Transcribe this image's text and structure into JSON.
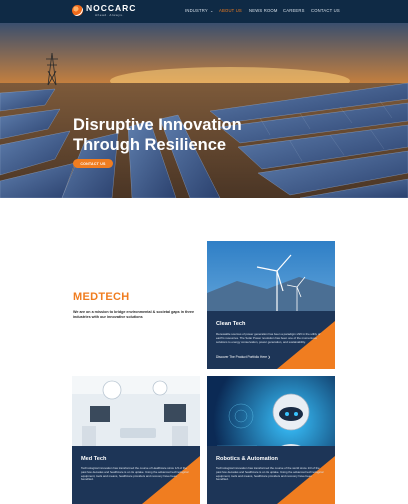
{
  "brand": {
    "name": "NOCCARC",
    "tagline": "Ahead. Always."
  },
  "nav": {
    "items": [
      {
        "label": "INDUSTRY",
        "has_dropdown": true
      },
      {
        "label": "ABOUT US",
        "active": true
      },
      {
        "label": "NEWS ROOM"
      },
      {
        "label": "CAREERS"
      },
      {
        "label": "CONTACT US"
      }
    ]
  },
  "hero": {
    "title": "Disruptive Innovation\nThrough Resilience",
    "cta_label": "CONTACT US",
    "slide_count": 5,
    "active_slide": 2
  },
  "section": {
    "title": "MEDTECH",
    "text": "We are on a mission to bridge environmental & societal gaps in three industries with our innovative solutions"
  },
  "cards": [
    {
      "title": "Clean Tech",
      "text": "Renewable sources of power generation has been a paradigm shift in the utility of earth's resources. The Solar Power revolution has been one of the momentous solutions to energy conservation, power generation, and sustainability.",
      "link": "Discover The Product Portfolio Here"
    },
    {
      "title": "Med Tech",
      "text": "Technological innovation has transformed the course of Healthcare since 1/3 of the past few decades and healthcare is on its uptake. Using the advanced technological equipment, tools and means, healthcare providers and recovery have been benefited."
    },
    {
      "title": "Robotics & Automation",
      "text": "Technological innovation has transformed the course of the world since 1/3 of the past few decades and healthcare is on its uptake. Using the advanced technological equipment, tools and means, healthcare providers and recovery have been benefited."
    }
  ],
  "colors": {
    "navy": "#0f2a45",
    "accent": "#f07d20",
    "card_panel": "#1d3557"
  }
}
